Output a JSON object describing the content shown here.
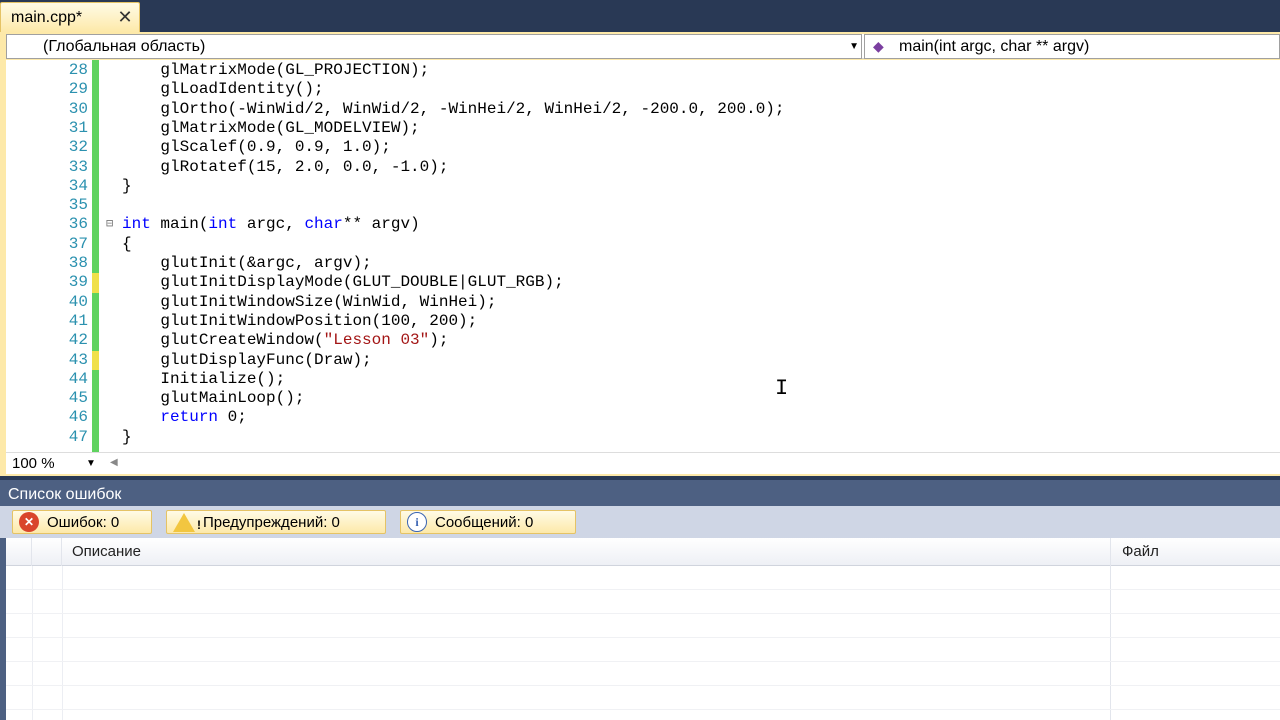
{
  "tab": {
    "title": "main.cpp*",
    "close": "✕"
  },
  "navbar": {
    "scope": "(Глобальная область)",
    "member": "main(int argc, char ** argv)",
    "member_icon": "method-icon"
  },
  "code": {
    "lines": [
      {
        "n": "28",
        "text": "    glMatrixMode(GL_PROJECTION);"
      },
      {
        "n": "29",
        "text": "    glLoadIdentity();"
      },
      {
        "n": "30",
        "text": "    glOrtho(-WinWid/2, WinWid/2, -WinHei/2, WinHei/2, -200.0, 200.0);"
      },
      {
        "n": "31",
        "text": "    glMatrixMode(GL_MODELVIEW);"
      },
      {
        "n": "32",
        "text": "    glScalef(0.9, 0.9, 1.0);"
      },
      {
        "n": "33",
        "text": "    glRotatef(15, 2.0, 0.0, -1.0);"
      },
      {
        "n": "34",
        "text": "}"
      },
      {
        "n": "35",
        "text": ""
      },
      {
        "n": "36",
        "text": "int main(int argc, char** argv)"
      },
      {
        "n": "37",
        "text": "{"
      },
      {
        "n": "38",
        "text": "    glutInit(&argc, argv);"
      },
      {
        "n": "39",
        "text": "    glutInitDisplayMode(GLUT_DOUBLE|GLUT_RGB);"
      },
      {
        "n": "40",
        "text": "    glutInitWindowSize(WinWid, WinHei);"
      },
      {
        "n": "41",
        "text": "    glutInitWindowPosition(100, 200);"
      },
      {
        "n": "42",
        "text": "    glutCreateWindow(\"Lesson 03\");"
      },
      {
        "n": "43",
        "text": "    glutDisplayFunc(Draw);"
      },
      {
        "n": "44",
        "text": "    Initialize();"
      },
      {
        "n": "45",
        "text": "    glutMainLoop();"
      },
      {
        "n": "46",
        "text": "    return 0;"
      },
      {
        "n": "47",
        "text": "}"
      }
    ],
    "cursor_glyph": "I"
  },
  "zoom": {
    "value": "100 %"
  },
  "errorlist": {
    "title": "Список ошибок",
    "errors_label": "Ошибок: 0",
    "warnings_label": "Предупреждений: 0",
    "messages_label": "Сообщений: 0",
    "col_description": "Описание",
    "col_file": "Файл"
  },
  "colors": {
    "accent": "#fde9a9",
    "frame": "#293955",
    "gutter_green": "#5fd35f",
    "gutter_yellow": "#f0e04a",
    "keyword": "#0000ff",
    "string": "#a31515",
    "line_number": "#2b91af"
  }
}
